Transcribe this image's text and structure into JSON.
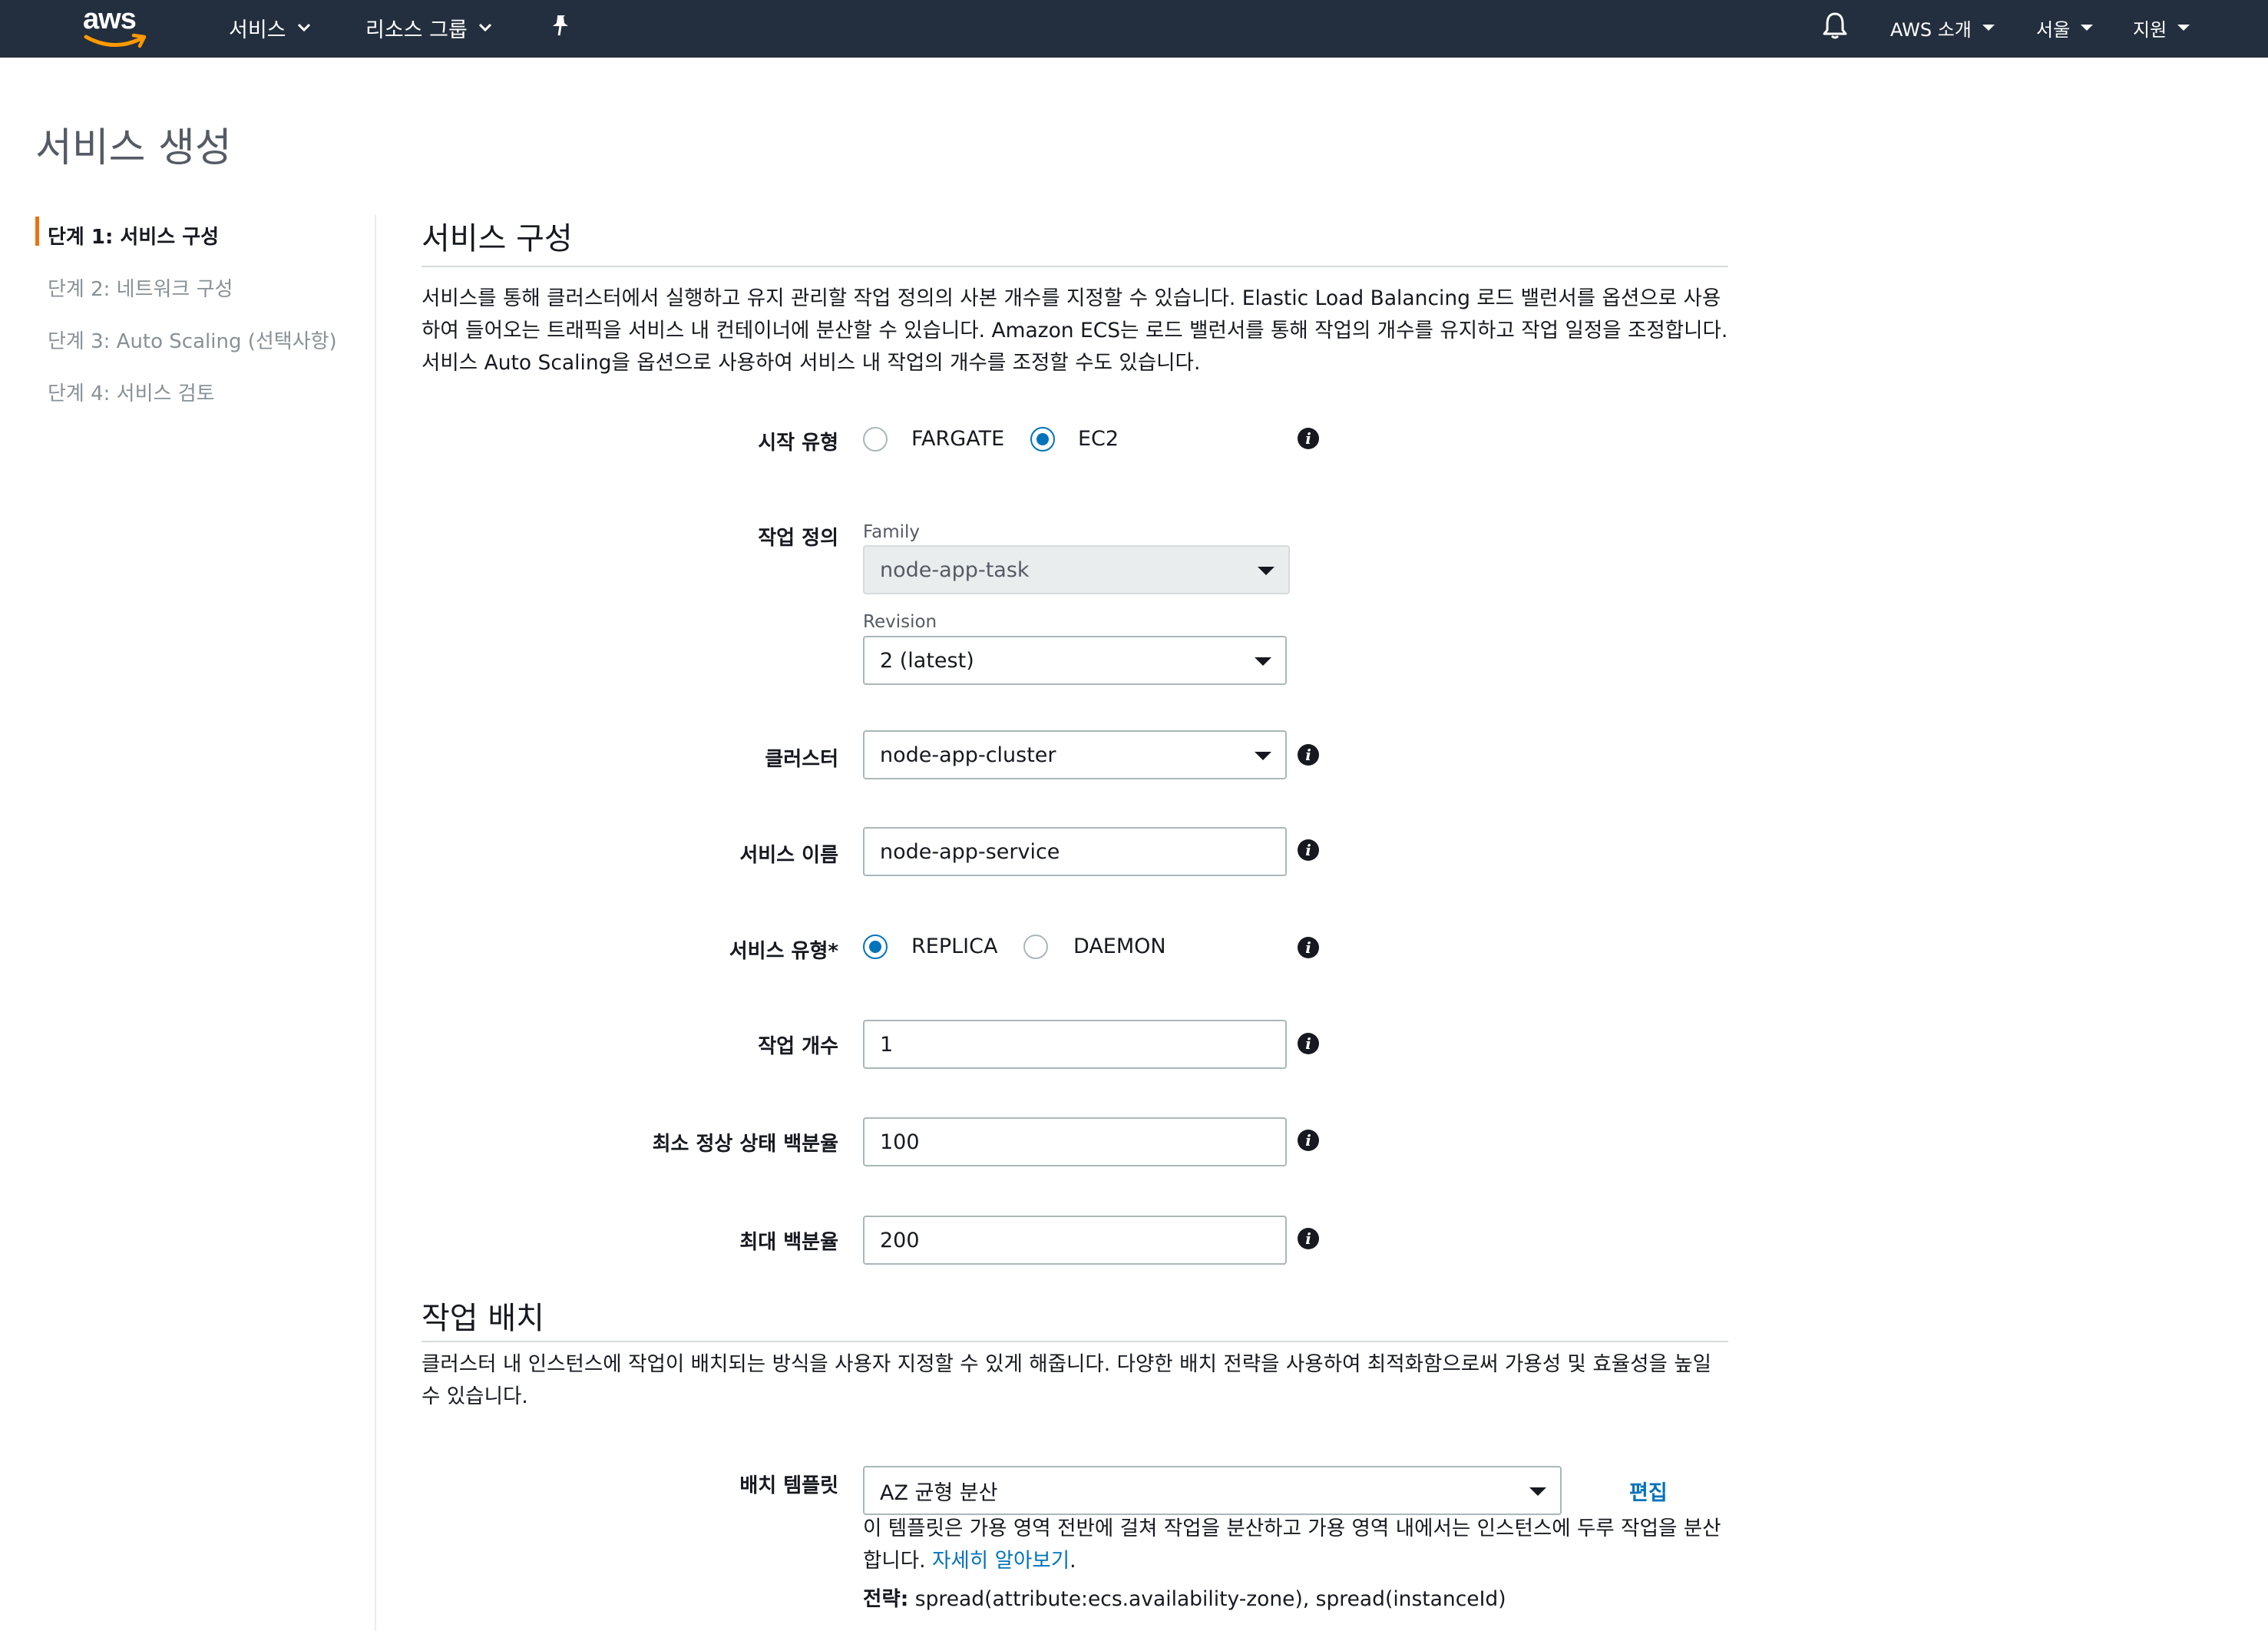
{
  "nav": {
    "logo": "aws",
    "services": "서비스",
    "resource_groups": "리소스 그룹",
    "account": "AWS 소개",
    "region": "서울",
    "support": "지원"
  },
  "page": {
    "title": "서비스 생성"
  },
  "steps": [
    {
      "label": "단계 1: 서비스 구성"
    },
    {
      "label": "단계 2: 네트워크 구성"
    },
    {
      "label": "단계 3: Auto Scaling (선택사항)"
    },
    {
      "label": "단계 4: 서비스 검토"
    }
  ],
  "service_config": {
    "title": "서비스 구성",
    "description": "서비스를 통해 클러스터에서 실행하고 유지 관리할 작업 정의의 사본 개수를 지정할 수 있습니다. Elastic Load Balancing 로드 밸런서를 옵션으로 사용하여 들어오는 트래픽을 서비스 내 컨테이너에 분산할 수 있습니다. Amazon ECS는 로드 밸런서를 통해 작업의 개수를 유지하고 작업 일정을 조정합니다. 서비스 Auto Scaling을 옵션으로 사용하여 서비스 내 작업의 개수를 조정할 수도 있습니다."
  },
  "form": {
    "launch_type": {
      "label": "시작 유형",
      "options": [
        "FARGATE",
        "EC2"
      ],
      "selected": "EC2"
    },
    "task_definition": {
      "label": "작업 정의",
      "family_label": "Family",
      "family_value": "node-app-task",
      "revision_label": "Revision",
      "revision_value": "2 (latest)"
    },
    "cluster": {
      "label": "클러스터",
      "value": "node-app-cluster"
    },
    "service_name": {
      "label": "서비스 이름",
      "value": "node-app-service"
    },
    "service_type": {
      "label": "서비스 유형*",
      "options": [
        "REPLICA",
        "DAEMON"
      ],
      "selected": "REPLICA"
    },
    "task_count": {
      "label": "작업 개수",
      "value": "1"
    },
    "min_healthy": {
      "label": "최소 정상 상태 백분율",
      "value": "100"
    },
    "max_percent": {
      "label": "최대 백분율",
      "value": "200"
    }
  },
  "placement": {
    "title": "작업 배치",
    "description": "클러스터 내 인스턴스에 작업이 배치되는 방식을 사용자 지정할 수 있게 해줍니다. 다양한 배치 전략을 사용하여 최적화함으로써 가용성 및 효율성을 높일 수 있습니다.",
    "template_label": "배치 템플릿",
    "template_value": "AZ 균형 분산",
    "edit_label": "편집",
    "help_text": "이 템플릿은 가용 영역 전반에 걸쳐 작업을 분산하고 가용 영역 내에서는 인스턴스에 두루 작업을 분산합니다.",
    "learn_more": "자세히 알아보기",
    "period": ".",
    "strategy_label": "전략:",
    "strategy_value": "spread(attribute:ecs.availability-zone), spread(instanceId)"
  },
  "colors": {
    "nav_bg": "#232f3e",
    "accent_orange": "#ec7211",
    "link_blue": "#0073bb",
    "radio_blue": "#0073bb"
  },
  "icons": [
    "bell-icon",
    "pin-icon",
    "info-icon",
    "chevron-down-icon",
    "caret-down-icon"
  ]
}
